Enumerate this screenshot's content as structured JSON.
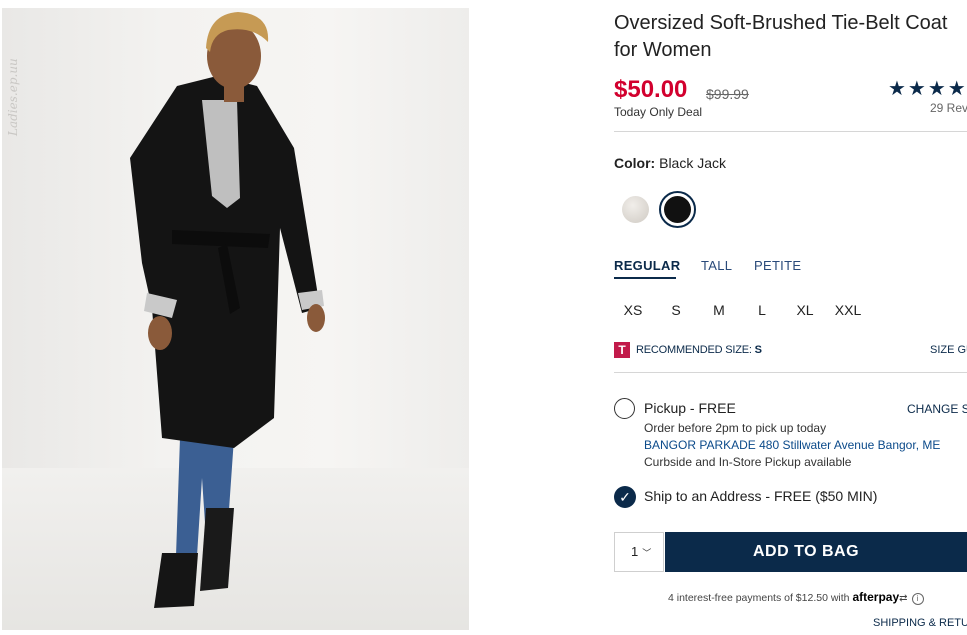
{
  "product": {
    "title": "Oversized Soft-Brushed Tie-Belt Coat for Women",
    "price": "$50.00",
    "original_price": "$99.99",
    "deal_label": "Today Only Deal",
    "stars": "★★★★",
    "reviews": "29 Rev"
  },
  "image": {
    "watermark": "Ladies.ep.uu"
  },
  "color": {
    "label": "Color:",
    "value": "Black Jack",
    "swatches": [
      {
        "name": "Light Grey",
        "hex": "#d9d5cf"
      },
      {
        "name": "Black Jack",
        "hex": "#111111",
        "selected": true
      }
    ]
  },
  "fit_tabs": [
    {
      "label": "REGULAR",
      "active": true
    },
    {
      "label": "TALL",
      "active": false
    },
    {
      "label": "PETITE",
      "active": false
    }
  ],
  "sizes": [
    "XS",
    "S",
    "M",
    "L",
    "XL",
    "XXL"
  ],
  "recommended": {
    "icon": "T",
    "label": "RECOMMENDED SIZE:",
    "value": "S",
    "size_guide": "SIZE GU"
  },
  "pickup": {
    "title": "Pickup - FREE",
    "change_store": "CHANGE ST",
    "subtitle": "Order before 2pm to pick up today",
    "store": "BANGOR PARKADE 480 Stillwater Avenue  Bangor, ME",
    "curbside": "Curbside and In-Store Pickup available"
  },
  "ship": {
    "label": "Ship to an Address - FREE ($50 MIN)"
  },
  "cart": {
    "quantity": "1",
    "add_label": "ADD TO BAG"
  },
  "afterpay": {
    "text": "4 interest-free payments of $12.50 with",
    "brand": "afterpay"
  },
  "footer": {
    "shipping_link": "SHIPPING & RETU"
  },
  "colors": {
    "primary_navy": "#0b2a4a",
    "sale_red": "#d2002e"
  }
}
